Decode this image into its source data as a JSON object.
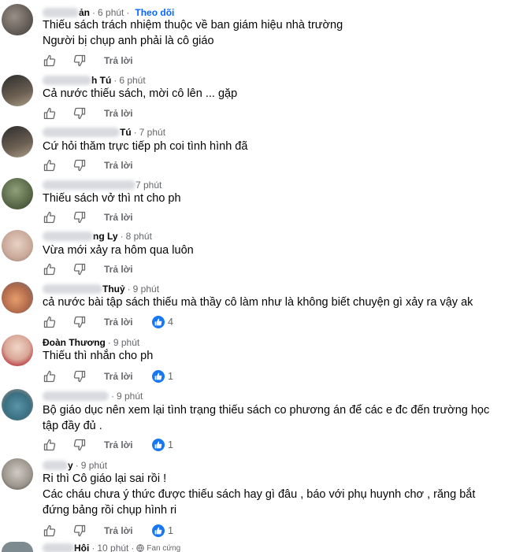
{
  "colors": {
    "text": "#050505",
    "meta": "#65676b",
    "accent": "#0866ff",
    "like": "#1877f2"
  },
  "icons": {
    "like": "thumbs-up-icon",
    "dislike": "thumbs-down-icon",
    "reaction": "like-reaction-icon",
    "privacy": "globe-icon"
  },
  "comments": [
    {
      "name": "ản",
      "time": "6 phút",
      "follow": "Theo dõi",
      "lines": [
        "Thiếu sách trách nhiệm thuộc về ban giám hiệu nhà trường",
        "Người bị chụp anh phải là cô giáo"
      ],
      "reply": "Trả lời",
      "reactions": ""
    },
    {
      "name": "h Tú",
      "time": "6 phút",
      "lines": [
        "Cả nước thiếu sách, mời cô lên ... gặp"
      ],
      "reply": "Trả lời",
      "reactions": ""
    },
    {
      "name": "Tú",
      "time": "7 phút",
      "lines": [
        "Cứ hỏi thăm trực tiếp ph coi tình hình đã"
      ],
      "reply": "Trả lời",
      "reactions": ""
    },
    {
      "name": "",
      "time": "7 phút",
      "lines": [
        "Thiếu sách vở thì nt cho ph"
      ],
      "reply": "Trả lời",
      "reactions": ""
    },
    {
      "name": "ng Ly",
      "time": "8 phút",
      "lines": [
        "Vừa mới xảy ra hôm qua luôn"
      ],
      "reply": "Trả lời",
      "reactions": ""
    },
    {
      "name": "Thuỷ",
      "time": "9 phút",
      "lines": [
        "cả nước bài tập sách thiếu mà thầy cô làm như là không biết chuyện gì xảy ra vậy ak"
      ],
      "reply": "Trả lời",
      "reactions": "4"
    },
    {
      "name": "Đoàn Thương",
      "time": "9 phút",
      "lines": [
        "Thiếu thì nhắn cho ph"
      ],
      "reply": "Trả lời",
      "reactions": "1"
    },
    {
      "name": "",
      "time": "9 phút",
      "lines": [
        "Bộ giáo dục nên xem lại tình trạng thiếu sách co phương án để các e đc đến trường học",
        "tập đầy đủ ."
      ],
      "reply": "Trả lời",
      "reactions": "1"
    },
    {
      "name": "y",
      "time": "9 phút",
      "lines": [
        "Ri thì Cô giáo lại sai rồi !",
        "Các cháu chưa ý thức được thiếu sách hay gì đâu , báo với phụ huynh chơ , răng bắt",
        "đứng bảng rồi chụp hình ri"
      ],
      "reply": "Trả lời",
      "reactions": "1"
    },
    {
      "name": "Hội",
      "time": "10 phút",
      "privacy": "Fan cứng",
      "lines": [],
      "reply": "",
      "reactions": ""
    }
  ]
}
